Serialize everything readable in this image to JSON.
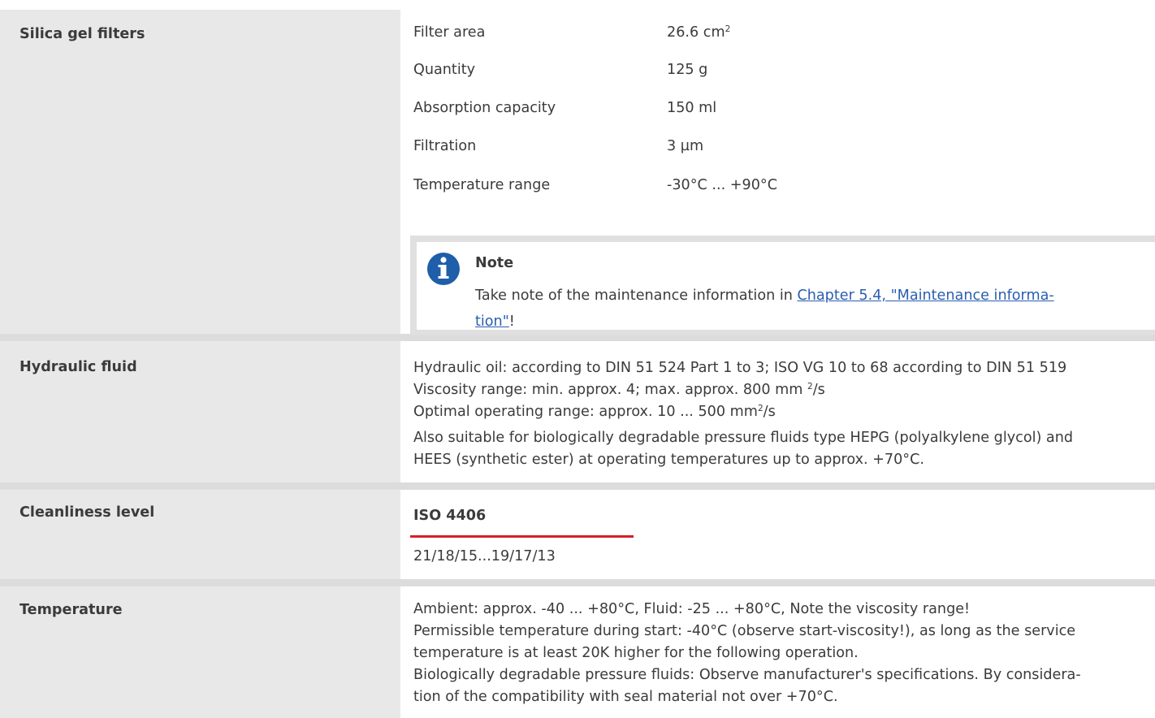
{
  "rows": {
    "silica": {
      "label": "Silica gel filters",
      "specs": [
        {
          "name": "Filter area",
          "value": "26.6 cm",
          "sup": "2"
        },
        {
          "name": "Quantity",
          "value": "125 g"
        },
        {
          "name": "Absorption capacity",
          "value": "150 ml"
        },
        {
          "name": "Filtration",
          "value": "3 µm"
        },
        {
          "name": "Temperature range",
          "value": "-30°C ... +90°C"
        }
      ],
      "note": {
        "title": "Note",
        "text_before": "Take note of the maintenance information in ",
        "link_line1": "Chapter 5.4, \"Maintenance informa-",
        "link_line2": "tion\"",
        "text_after": "!"
      }
    },
    "hydraulic": {
      "label": "Hydraulic fluid",
      "line1": "Hydraulic oil: according to DIN 51 524 Part 1 to 3; ISO VG 10 to 68 according to DIN 51 519",
      "line2a": "Viscosity range: min. approx. 4; max. approx. 800 mm ",
      "line2sup": "2",
      "line2b": "/s",
      "line3a": "Optimal operating range: approx. 10 ... 500 mm",
      "line3sup": "2",
      "line3b": "/s",
      "line4": "Also suitable for biologically degradable pressure fluids type HEPG (polyalkylene glycol) and",
      "line5": "HEES (synthetic ester) at operating temperatures up to approx. +70°C."
    },
    "cleanliness": {
      "label": "Cleanliness level",
      "heading": "ISO 4406",
      "value": "21/18/15...19/17/13"
    },
    "temperature": {
      "label": "Temperature",
      "lines": [
        "Ambient: approx. -40 ... +80°C, Fluid: -25 ... +80°C, Note the viscosity range!",
        "Permissible temperature during start: -40°C (observe start-viscosity!), as long as the service",
        "temperature is at least 20K higher for the following operation.",
        "Biologically degradable pressure fluids: Observe manufacturer's specifications. By considera-",
        "tion of the compatibility with seal material not over +70°C."
      ]
    }
  },
  "colors": {
    "label_bg": "#e8e8e8",
    "separator": "#dcdcdc",
    "accent_red": "#d4202a",
    "link": "#2a5db0",
    "info_blue": "#1f5ea8"
  },
  "icons": {
    "note": "info-icon"
  }
}
